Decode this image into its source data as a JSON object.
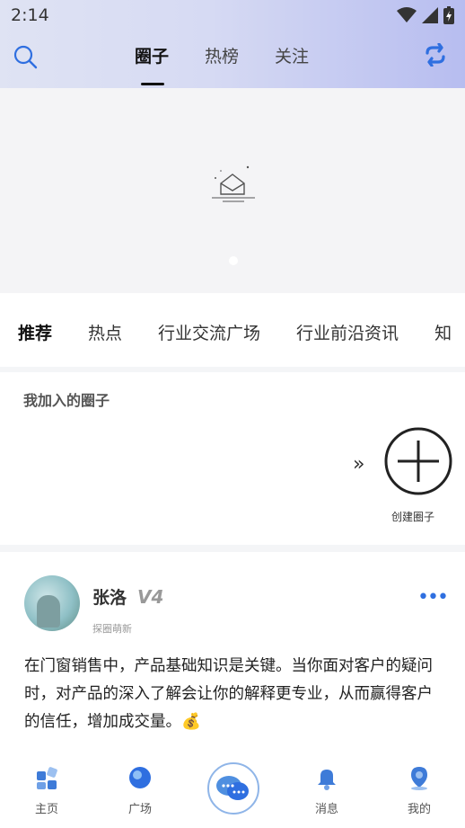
{
  "status_bar": {
    "time": "2:14"
  },
  "top_tabs": [
    {
      "label": "圈子",
      "active": true
    },
    {
      "label": "热榜",
      "active": false
    },
    {
      "label": "关注",
      "active": false
    }
  ],
  "categories": [
    {
      "label": "推荐",
      "active": true
    },
    {
      "label": "热点",
      "active": false
    },
    {
      "label": "行业交流广场",
      "active": false
    },
    {
      "label": "行业前沿资讯",
      "active": false
    },
    {
      "label": "知",
      "active": false
    }
  ],
  "my_circles": {
    "title": "我加入的圈子",
    "arrows": "»",
    "create_label": "创建圈子"
  },
  "post": {
    "author": "张洛",
    "badge": "V4",
    "level": "探圈萌新",
    "content": "在门窗销售中，产品基础知识是关键。当你面对客户的疑问时，对产品的深入了解会让你的解释更专业，从而赢得客户的信任，增加成交量。💰"
  },
  "bottom_nav": [
    {
      "label": "主页",
      "icon": "home-icon"
    },
    {
      "label": "广场",
      "icon": "square-icon"
    },
    {
      "label": "",
      "icon": "chat-bubble-icon"
    },
    {
      "label": "消息",
      "icon": "bell-icon"
    },
    {
      "label": "我的",
      "icon": "profile-icon"
    }
  ],
  "colors": {
    "accent": "#2f6fe0",
    "header_start": "#dfe3f3",
    "header_end": "#b7bdf0"
  }
}
